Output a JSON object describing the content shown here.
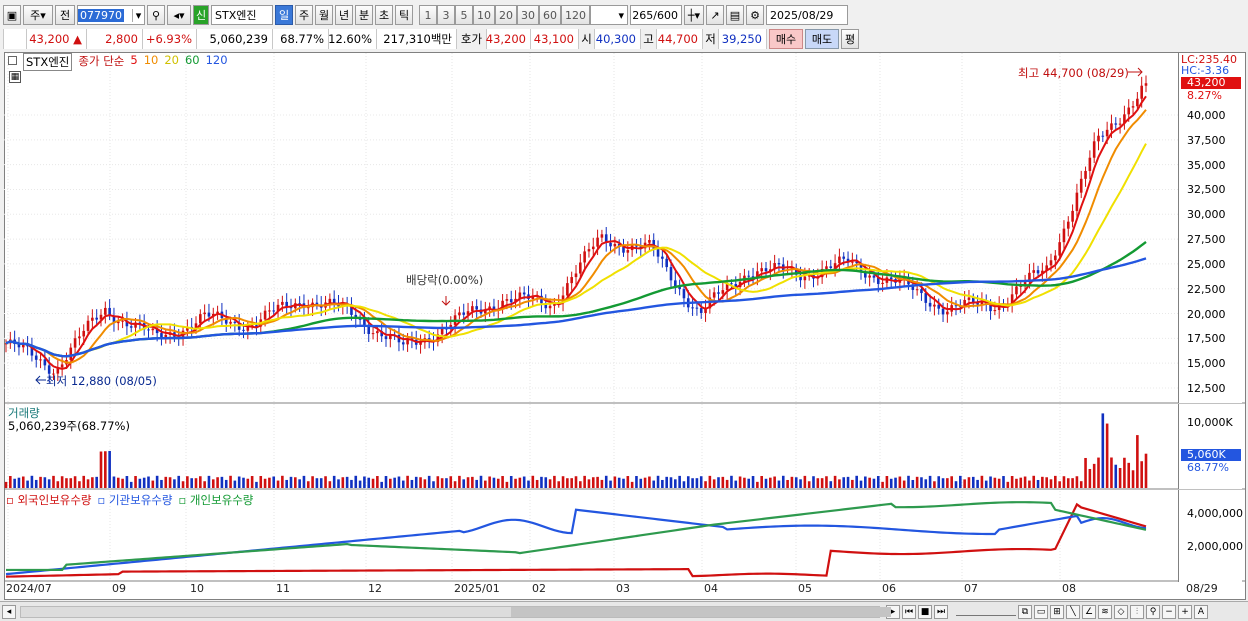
{
  "toolbar": {
    "stock_type": "주",
    "prev_label": "전",
    "stock_code": "077970",
    "new_tag": "신",
    "stock_name": "STX엔진",
    "periods": [
      "일",
      "주",
      "월",
      "년",
      "분",
      "초",
      "틱"
    ],
    "active_period": "일",
    "intervals": [
      "1",
      "3",
      "5",
      "10",
      "20",
      "30",
      "60",
      "120"
    ],
    "count": "265",
    "count_total": "/600",
    "date": "2025/08/29"
  },
  "info": {
    "price": "43,200",
    "arrow": "▲",
    "change": "2,800",
    "change_pct": "+6.93%",
    "volume": "5,060,239",
    "vol_ratio": "68.77%",
    "turnover": "12.60%",
    "amount": "217,310백만",
    "quote_label": "호가",
    "ask": "43,200",
    "bid": "43,100",
    "open_label": "시",
    "open": "40,300",
    "high_label": "고",
    "high": "44,700",
    "low_label": "저",
    "low": "39,250",
    "buy_label": "매수",
    "sell_label": "매도",
    "eval_label": "평"
  },
  "legend": {
    "name": "STX엔진",
    "ma_title": "종가 단순",
    "ma5": "5",
    "ma10": "10",
    "ma20": "20",
    "ma60": "60",
    "ma120": "120"
  },
  "annotations": {
    "high": "최고 44,700 (08/29)",
    "low": "최저 12,880 (08/05)",
    "dividend": "배당락(0.00%)",
    "lc": "LC:235.40",
    "hc": "HC:-3.36",
    "price_tag": "43,200",
    "pct_tag": "8.27%"
  },
  "volume_panel": {
    "title": "거래량",
    "value": "5,060,239주(68.77%)",
    "ticks": [
      "10,000K"
    ],
    "tag": "5,060K",
    "tag_pct": "68.77%"
  },
  "holdings_panel": {
    "series": [
      "외국인보유수량",
      "기관보유수량",
      "개인보유수량"
    ],
    "ticks": [
      "4,000,000",
      "2,000,000"
    ]
  },
  "colors": {
    "up": "#d01010",
    "down": "#1030c0",
    "ma5": "#e01010",
    "ma10": "#f08c00",
    "ma20": "#f0e000",
    "ma60": "#139a33",
    "ma120": "#2356e0"
  },
  "chart_data": [
    {
      "type": "candlestick",
      "title": "STX엔진",
      "x": [
        "2024/07",
        "09",
        "10",
        "11",
        "12",
        "2025/01",
        "02",
        "03",
        "04",
        "05",
        "06",
        "07",
        "08",
        "08/29"
      ],
      "yticks": [
        12500,
        15000,
        17500,
        20000,
        22500,
        25000,
        27500,
        30000,
        32500,
        35000,
        37500,
        40000
      ],
      "ylim": [
        11200,
        46000
      ],
      "close_approx": [
        17000,
        14500,
        20500,
        17500,
        19500,
        19000,
        21500,
        20000,
        16500,
        19000,
        21500,
        21000,
        27500,
        26500,
        20000,
        24500,
        24000,
        25000,
        23000,
        20500,
        21000,
        24500,
        37000,
        43200
      ],
      "moving_averages": [
        "5",
        "10",
        "20",
        "60",
        "120"
      ],
      "high": {
        "value": 44700,
        "date": "08/29"
      },
      "low": {
        "value": 12880,
        "date": "08/05"
      }
    },
    {
      "type": "bar",
      "title": "거래량",
      "yticks": [
        10000
      ],
      "unit": "K",
      "last_value": 5060
    },
    {
      "type": "line",
      "series": [
        {
          "name": "외국인보유수량"
        },
        {
          "name": "기관보유수량"
        },
        {
          "name": "개인보유수량"
        }
      ],
      "yticks": [
        2000000,
        4000000
      ]
    }
  ]
}
